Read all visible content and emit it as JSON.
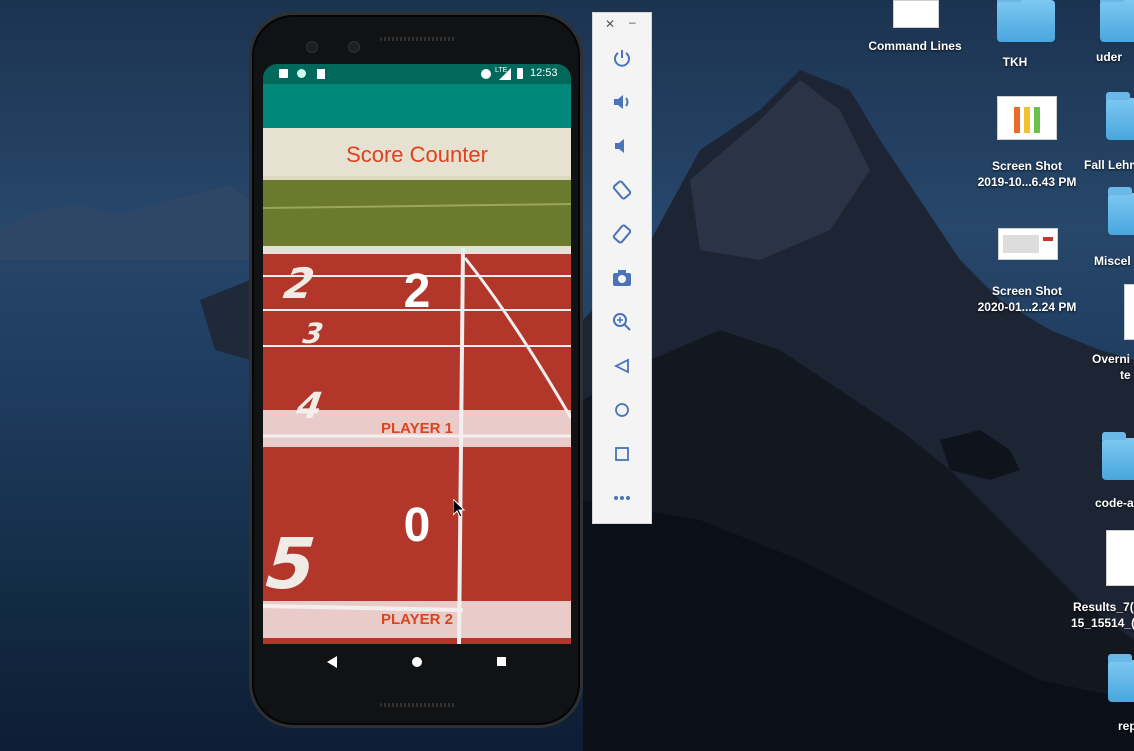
{
  "desktop": {
    "icons": [
      {
        "label": "Command Lines"
      },
      {
        "label": "TKH"
      },
      {
        "label": "uder"
      },
      {
        "label": "Screen Shot\n2019-10...6.43 PM"
      },
      {
        "label": "Fall Lehm"
      },
      {
        "label": "Miscel"
      },
      {
        "label": "Screen Shot\n2020-01...2.24 PM"
      },
      {
        "label": "Overni"
      },
      {
        "label": "te"
      },
      {
        "label": "code-a"
      },
      {
        "label": "Results_7("
      },
      {
        "label": "15_15514_("
      },
      {
        "label": "rep"
      }
    ]
  },
  "status_bar": {
    "time": "12:53",
    "network": "LTE"
  },
  "app": {
    "title": "Score Counter",
    "player1": {
      "score": "2",
      "label": "PLAYER 1"
    },
    "player2": {
      "score": "0",
      "label": "PLAYER 2"
    }
  },
  "emulator_toolbar": {
    "buttons": [
      "power",
      "volume-up",
      "volume-down",
      "rotate-left",
      "rotate-right",
      "screenshot",
      "zoom",
      "back",
      "home",
      "overview",
      "more"
    ]
  },
  "colors": {
    "app_bar": "#00897b",
    "status_bar": "#00695c",
    "title_text": "#e3401b",
    "player_text": "#d8451f"
  }
}
